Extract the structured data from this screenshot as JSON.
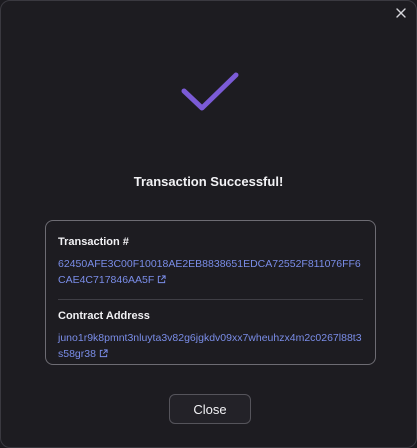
{
  "modal": {
    "title": "Transaction Successful!",
    "close_icon": "close-icon",
    "status_icon": "checkmark-icon",
    "accent_color": "#7b5bd6",
    "link_color": "#7a8de8"
  },
  "details": {
    "transaction_label": "Transaction #",
    "transaction_hash": "62450AFE3C00F10018AE2EB8838651EDCA72552F811076FF6CAE4C717846AA5F",
    "contract_label": "Contract Address",
    "contract_address": "juno1r9k8pmnt3nluyta3v82g6jgkdv09xx7wheuhzx4m2c0267l88t3s58gr38",
    "link_icon": "external-link-icon"
  },
  "footer": {
    "close_label": "Close"
  }
}
